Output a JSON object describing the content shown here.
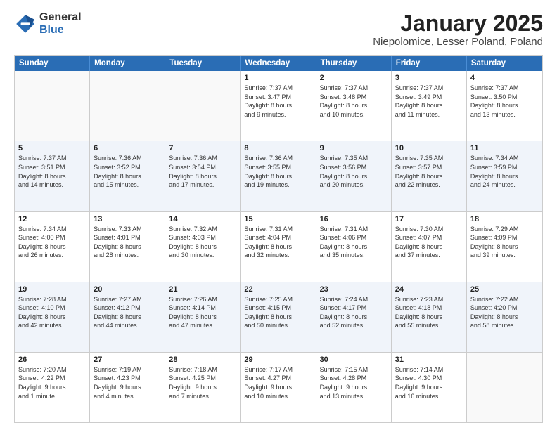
{
  "logo": {
    "general": "General",
    "blue": "Blue"
  },
  "title": "January 2025",
  "subtitle": "Niepolomice, Lesser Poland, Poland",
  "header_days": [
    "Sunday",
    "Monday",
    "Tuesday",
    "Wednesday",
    "Thursday",
    "Friday",
    "Saturday"
  ],
  "weeks": [
    [
      {
        "day": "",
        "info": "",
        "empty": true
      },
      {
        "day": "",
        "info": "",
        "empty": true
      },
      {
        "day": "",
        "info": "",
        "empty": true
      },
      {
        "day": "1",
        "info": "Sunrise: 7:37 AM\nSunset: 3:47 PM\nDaylight: 8 hours\nand 9 minutes."
      },
      {
        "day": "2",
        "info": "Sunrise: 7:37 AM\nSunset: 3:48 PM\nDaylight: 8 hours\nand 10 minutes."
      },
      {
        "day": "3",
        "info": "Sunrise: 7:37 AM\nSunset: 3:49 PM\nDaylight: 8 hours\nand 11 minutes."
      },
      {
        "day": "4",
        "info": "Sunrise: 7:37 AM\nSunset: 3:50 PM\nDaylight: 8 hours\nand 13 minutes."
      }
    ],
    [
      {
        "day": "5",
        "info": "Sunrise: 7:37 AM\nSunset: 3:51 PM\nDaylight: 8 hours\nand 14 minutes."
      },
      {
        "day": "6",
        "info": "Sunrise: 7:36 AM\nSunset: 3:52 PM\nDaylight: 8 hours\nand 15 minutes."
      },
      {
        "day": "7",
        "info": "Sunrise: 7:36 AM\nSunset: 3:54 PM\nDaylight: 8 hours\nand 17 minutes."
      },
      {
        "day": "8",
        "info": "Sunrise: 7:36 AM\nSunset: 3:55 PM\nDaylight: 8 hours\nand 19 minutes."
      },
      {
        "day": "9",
        "info": "Sunrise: 7:35 AM\nSunset: 3:56 PM\nDaylight: 8 hours\nand 20 minutes."
      },
      {
        "day": "10",
        "info": "Sunrise: 7:35 AM\nSunset: 3:57 PM\nDaylight: 8 hours\nand 22 minutes."
      },
      {
        "day": "11",
        "info": "Sunrise: 7:34 AM\nSunset: 3:59 PM\nDaylight: 8 hours\nand 24 minutes."
      }
    ],
    [
      {
        "day": "12",
        "info": "Sunrise: 7:34 AM\nSunset: 4:00 PM\nDaylight: 8 hours\nand 26 minutes."
      },
      {
        "day": "13",
        "info": "Sunrise: 7:33 AM\nSunset: 4:01 PM\nDaylight: 8 hours\nand 28 minutes."
      },
      {
        "day": "14",
        "info": "Sunrise: 7:32 AM\nSunset: 4:03 PM\nDaylight: 8 hours\nand 30 minutes."
      },
      {
        "day": "15",
        "info": "Sunrise: 7:31 AM\nSunset: 4:04 PM\nDaylight: 8 hours\nand 32 minutes."
      },
      {
        "day": "16",
        "info": "Sunrise: 7:31 AM\nSunset: 4:06 PM\nDaylight: 8 hours\nand 35 minutes."
      },
      {
        "day": "17",
        "info": "Sunrise: 7:30 AM\nSunset: 4:07 PM\nDaylight: 8 hours\nand 37 minutes."
      },
      {
        "day": "18",
        "info": "Sunrise: 7:29 AM\nSunset: 4:09 PM\nDaylight: 8 hours\nand 39 minutes."
      }
    ],
    [
      {
        "day": "19",
        "info": "Sunrise: 7:28 AM\nSunset: 4:10 PM\nDaylight: 8 hours\nand 42 minutes."
      },
      {
        "day": "20",
        "info": "Sunrise: 7:27 AM\nSunset: 4:12 PM\nDaylight: 8 hours\nand 44 minutes."
      },
      {
        "day": "21",
        "info": "Sunrise: 7:26 AM\nSunset: 4:14 PM\nDaylight: 8 hours\nand 47 minutes."
      },
      {
        "day": "22",
        "info": "Sunrise: 7:25 AM\nSunset: 4:15 PM\nDaylight: 8 hours\nand 50 minutes."
      },
      {
        "day": "23",
        "info": "Sunrise: 7:24 AM\nSunset: 4:17 PM\nDaylight: 8 hours\nand 52 minutes."
      },
      {
        "day": "24",
        "info": "Sunrise: 7:23 AM\nSunset: 4:18 PM\nDaylight: 8 hours\nand 55 minutes."
      },
      {
        "day": "25",
        "info": "Sunrise: 7:22 AM\nSunset: 4:20 PM\nDaylight: 8 hours\nand 58 minutes."
      }
    ],
    [
      {
        "day": "26",
        "info": "Sunrise: 7:20 AM\nSunset: 4:22 PM\nDaylight: 9 hours\nand 1 minute."
      },
      {
        "day": "27",
        "info": "Sunrise: 7:19 AM\nSunset: 4:23 PM\nDaylight: 9 hours\nand 4 minutes."
      },
      {
        "day": "28",
        "info": "Sunrise: 7:18 AM\nSunset: 4:25 PM\nDaylight: 9 hours\nand 7 minutes."
      },
      {
        "day": "29",
        "info": "Sunrise: 7:17 AM\nSunset: 4:27 PM\nDaylight: 9 hours\nand 10 minutes."
      },
      {
        "day": "30",
        "info": "Sunrise: 7:15 AM\nSunset: 4:28 PM\nDaylight: 9 hours\nand 13 minutes."
      },
      {
        "day": "31",
        "info": "Sunrise: 7:14 AM\nSunset: 4:30 PM\nDaylight: 9 hours\nand 16 minutes."
      },
      {
        "day": "",
        "info": "",
        "empty": true
      }
    ]
  ]
}
